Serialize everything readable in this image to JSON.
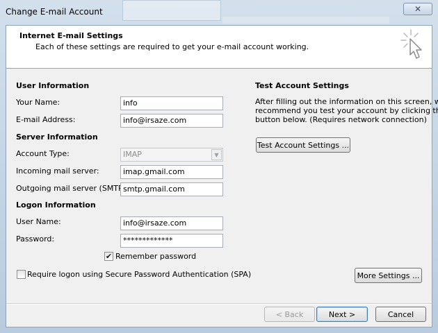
{
  "window": {
    "title": "Change E-mail Account",
    "close_glyph": "✕"
  },
  "header": {
    "title": "Internet E-mail Settings",
    "description": "Each of these settings are required to get your e-mail account working."
  },
  "user_info": {
    "heading": "User Information",
    "name_label": "Your Name:",
    "name_value": "info",
    "email_label": "E-mail Address:",
    "email_value": "info@irsaze.com"
  },
  "server_info": {
    "heading": "Server Information",
    "account_type_label": "Account Type:",
    "account_type_value": "IMAP",
    "incoming_label": "Incoming mail server:",
    "incoming_value": "imap.gmail.com",
    "outgoing_label": "Outgoing mail server (SMTP):",
    "outgoing_value": "smtp.gmail.com"
  },
  "logon_info": {
    "heading": "Logon Information",
    "username_label": "User Name:",
    "username_value": "info@irsaze.com",
    "password_label": "Password:",
    "password_value": "*************",
    "remember_label": "Remember password",
    "remember_checked": true,
    "spa_label": "Require logon using Secure Password Authentication (SPA)",
    "spa_checked": false
  },
  "test": {
    "heading": "Test Account Settings",
    "description_line1": "After filling out the information on this screen, we",
    "description_line2": "recommend you test your account by clicking the",
    "description_line3": "button below. (Requires network connection)",
    "button_label": "Test Account Settings ..."
  },
  "buttons": {
    "more_settings": "More Settings ...",
    "back": "< Back",
    "next": "Next >",
    "cancel": "Cancel"
  },
  "icons": {
    "close": "close-icon",
    "header_art": "cursor-sparkle-icon",
    "dropdown": "chevron-down-icon",
    "check": "checkmark-icon"
  }
}
